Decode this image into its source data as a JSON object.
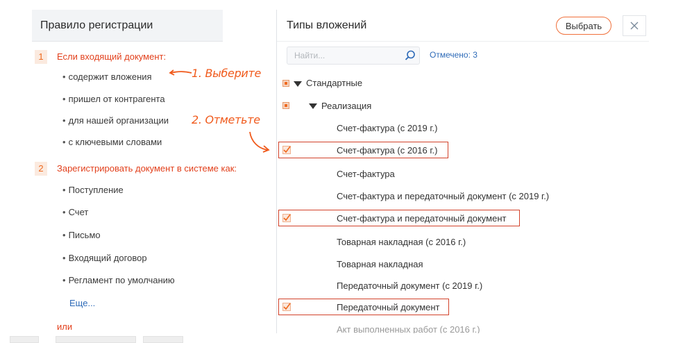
{
  "left_panel": {
    "title": "Правило регистрации",
    "step1": {
      "number": "1",
      "title": "Если входящий документ:",
      "items": [
        "содержит вложения",
        "пришел от контрагента",
        "для нашей организации",
        "с ключевыми словами"
      ]
    },
    "step2": {
      "number": "2",
      "title": "Зарегистрировать документ в системе как:",
      "items": [
        "Поступление",
        "Счет",
        "Письмо",
        "Входящий договор",
        "Регламент по умолчанию"
      ],
      "more_link": "Еще..."
    },
    "or_text": "или"
  },
  "annotations": {
    "choose": "1. Выберите",
    "mark": "2. Отметьте"
  },
  "right_panel": {
    "title": "Типы вложений",
    "select_button": "Выбрать",
    "search_placeholder": "Найти...",
    "checked_count": "Отмечено: 3",
    "tree": {
      "group": "Стандартные",
      "subgroup": "Реализация",
      "items": [
        {
          "label": "Счет-фактура (с 2019 г.)",
          "checked": false
        },
        {
          "label": "Счет-фактура (с 2016 г.)",
          "checked": true
        },
        {
          "label": "Счет-фактура",
          "checked": false
        },
        {
          "label": "Счет-фактура и передаточный документ (с 2019 г.)",
          "checked": false
        },
        {
          "label": "Счет-фактура и передаточный документ",
          "checked": true
        },
        {
          "label": "Товарная накладная (с 2016 г.)",
          "checked": false
        },
        {
          "label": "Товарная накладная",
          "checked": false
        },
        {
          "label": "Передаточный документ (с 2019 г.)",
          "checked": false
        },
        {
          "label": "Передаточный документ",
          "checked": true
        },
        {
          "label": "Акт выполненных работ (с 2016 г.)",
          "checked": false
        }
      ]
    }
  },
  "colors": {
    "accent": "#f05a1c",
    "step_title": "#e2401c",
    "link": "#2e6bb8",
    "highlight_border": "#d2422a"
  },
  "icons": {
    "search": "search-icon",
    "close": "close-icon",
    "expand": "triangle-down-icon",
    "partial": "partial-check-icon",
    "check": "checkmark-icon",
    "arrow": "arrow-icon"
  }
}
